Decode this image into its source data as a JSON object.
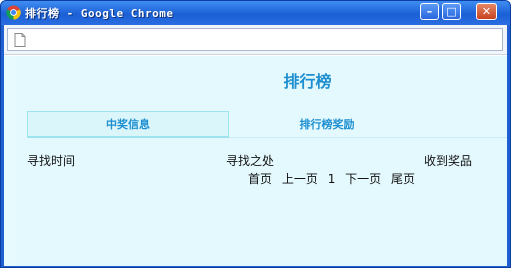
{
  "window": {
    "title": "排行榜 - Google Chrome",
    "controls": {
      "minimize": "–",
      "maximize": "□",
      "close": "✕"
    }
  },
  "page": {
    "heading": "排行榜",
    "tabs": [
      {
        "label": "中奖信息",
        "active": true
      },
      {
        "label": "排行榜奖励",
        "active": false
      }
    ],
    "columns": {
      "time": "寻找时间",
      "place": "寻找之处",
      "prize": "收到奖品"
    },
    "pager": {
      "first": "首页",
      "prev": "上一页",
      "current": "1",
      "next": "下一页",
      "last": "尾页"
    }
  },
  "colors": {
    "accent": "#1d8fd0",
    "page_background": "#e4f9fe",
    "titlebar": "#1f5fcf"
  },
  "icons": {
    "app": "chrome-icon",
    "page": "blank-page-icon"
  }
}
